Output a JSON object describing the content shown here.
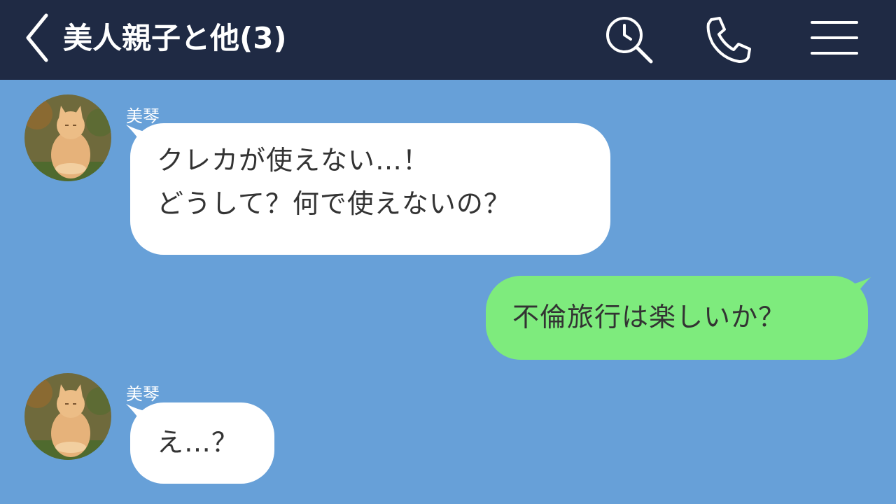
{
  "header": {
    "title": "美人親子と他(3)",
    "back_icon": "chevron-left-icon",
    "search_icon": "search-clock-icon",
    "call_icon": "phone-icon",
    "menu_icon": "hamburger-menu-icon"
  },
  "colors": {
    "header_bg": "#1f2a44",
    "chat_bg": "#67a0d8",
    "received_bubble": "#ffffff",
    "sent_bubble": "#7eeb7d",
    "text": "#333333"
  },
  "messages": [
    {
      "direction": "received",
      "sender": "美琴",
      "avatar": "orange-cat-photo",
      "lines": [
        "クレカが使えない…！",
        "どうして？何で使えないの？"
      ]
    },
    {
      "direction": "sent",
      "lines": [
        "不倫旅行は楽しいか？"
      ]
    },
    {
      "direction": "received",
      "sender": "美琴",
      "avatar": "orange-cat-photo",
      "lines": [
        "え…？"
      ]
    }
  ]
}
